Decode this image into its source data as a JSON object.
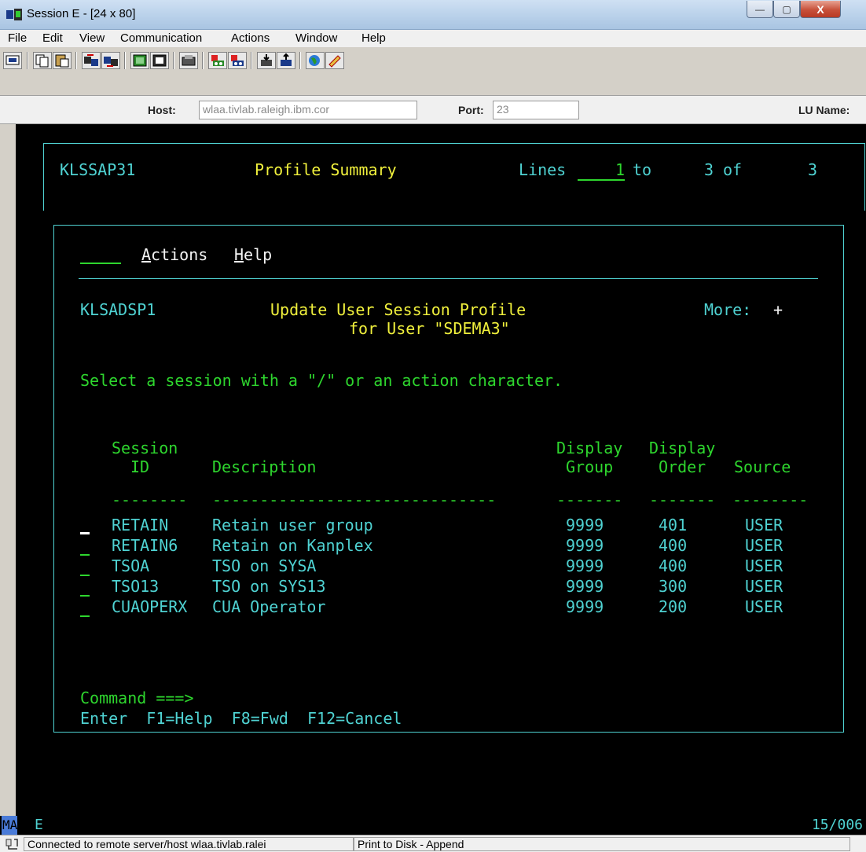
{
  "window": {
    "title": "Session E - [24 x 80]",
    "buttons": {
      "minimize": "—",
      "maximize": "▢",
      "close": "X"
    }
  },
  "menu": [
    "File",
    "Edit",
    "View",
    "Communication",
    "Actions",
    "Window",
    "Help"
  ],
  "toolbar_icons": [
    "display-icon",
    "copy-icon",
    "paste-icon",
    "send-icon",
    "receive-icon",
    "macro-icon",
    "keypad-icon",
    "clipboard-icon",
    "record-icon",
    "play-icon",
    "download-icon",
    "upload-icon",
    "web-icon",
    "help-icon"
  ],
  "host": {
    "host_label": "Host:",
    "host_value": "wlaa.tivlab.raleigh.ibm.cor",
    "port_label": "Port:",
    "port_value": "23",
    "lu_label": "LU Name:"
  },
  "outer_panel": {
    "panel_id": "KLSSAP31",
    "title": "Profile Summary",
    "lines_label": "Lines",
    "lines_from": "1",
    "lines_to_label": "to",
    "lines_to": "3",
    "of_label": "of",
    "total": "3"
  },
  "inner_panel": {
    "action_bar": {
      "actions": "Actions",
      "help": "Help"
    },
    "panel_id": "KLSADSP1",
    "title_line1": "Update User Session Profile",
    "title_line2": "for User \"SDEMA3\"",
    "more_label": "More:",
    "more_value": "+",
    "instruction": "Select a session with a \"/\" or an action character.",
    "columns": {
      "session_top": "Session",
      "session_bottom": "ID",
      "description": "Description",
      "dgroup_top": "Display",
      "dgroup_bottom": "Group",
      "dorder_top": "Display",
      "dorder_bottom": "Order",
      "source": "Source"
    },
    "separators": {
      "session": "--------",
      "description": "------------------------------",
      "group": "-------",
      "order": "-------",
      "source": "--------"
    },
    "rows": [
      {
        "id": "RETAIN",
        "description": "Retain user group",
        "group": "9999",
        "order": "401",
        "source": "USER"
      },
      {
        "id": "RETAIN6",
        "description": "Retain on Kanplex",
        "group": "9999",
        "order": "400",
        "source": "USER"
      },
      {
        "id": "TSOA",
        "description": "TSO on SYSA",
        "group": "9999",
        "order": "400",
        "source": "USER"
      },
      {
        "id": "TSO13",
        "description": "TSO on SYS13",
        "group": "9999",
        "order": "300",
        "source": "USER"
      },
      {
        "id": "CUAOPERX",
        "description": "CUA Operator",
        "group": "9999",
        "order": "200",
        "source": "USER"
      }
    ],
    "command_label": "Command ===>",
    "function_keys": "Enter  F1=Help  F8=Fwd  F12=Cancel"
  },
  "oia": {
    "mode": "MA",
    "session": "E",
    "cursor": "15/006"
  },
  "statusbar": {
    "connection": "Connected to remote server/host wlaa.tivlab.ralei",
    "print": "Print to Disk - Append"
  }
}
